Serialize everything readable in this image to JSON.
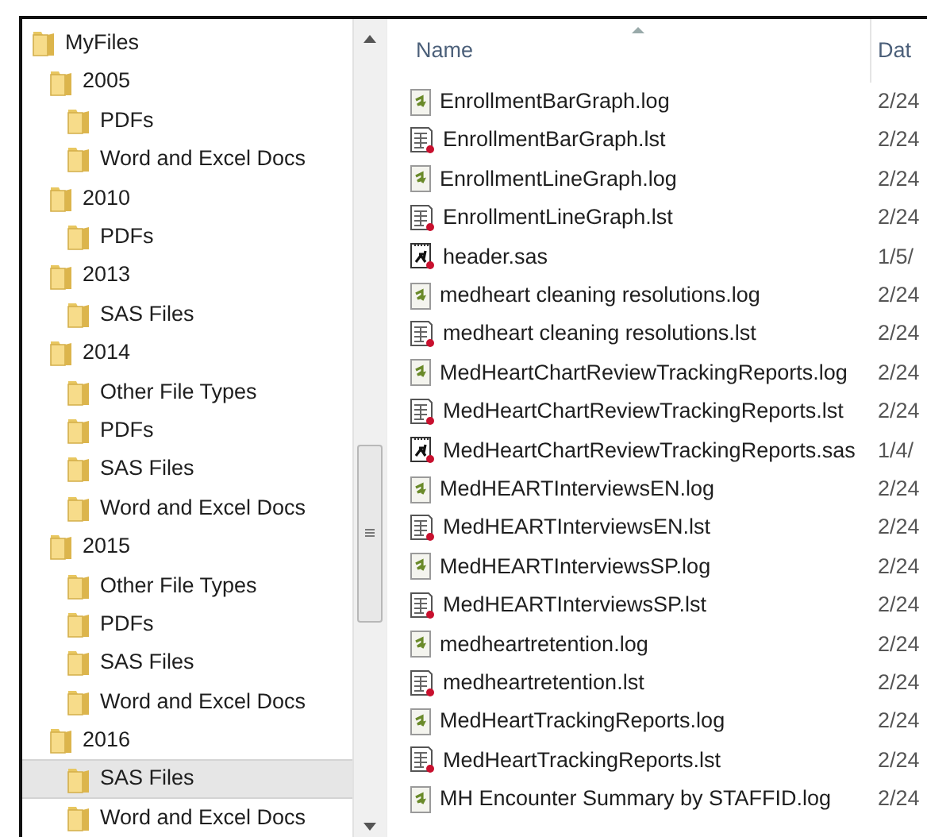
{
  "folder_tree": {
    "label": "MyFiles",
    "selected": false,
    "children": [
      {
        "label": "2005",
        "selected": false,
        "children": [
          {
            "label": "PDFs",
            "selected": false
          },
          {
            "label": "Word and Excel Docs",
            "selected": false
          }
        ]
      },
      {
        "label": "2010",
        "selected": false,
        "children": [
          {
            "label": "PDFs",
            "selected": false
          }
        ]
      },
      {
        "label": "2013",
        "selected": false,
        "children": [
          {
            "label": "SAS Files",
            "selected": false
          }
        ]
      },
      {
        "label": "2014",
        "selected": false,
        "children": [
          {
            "label": "Other File Types",
            "selected": false
          },
          {
            "label": "PDFs",
            "selected": false
          },
          {
            "label": "SAS Files",
            "selected": false
          },
          {
            "label": "Word and Excel Docs",
            "selected": false
          }
        ]
      },
      {
        "label": "2015",
        "selected": false,
        "children": [
          {
            "label": "Other File Types",
            "selected": false
          },
          {
            "label": "PDFs",
            "selected": false
          },
          {
            "label": "SAS Files",
            "selected": false
          },
          {
            "label": "Word and Excel Docs",
            "selected": false
          }
        ]
      },
      {
        "label": "2016",
        "selected": false,
        "children": [
          {
            "label": "SAS Files",
            "selected": true
          },
          {
            "label": "Word and Excel Docs",
            "selected": false
          }
        ]
      }
    ]
  },
  "file_list": {
    "columns": [
      "Name",
      "Dat"
    ],
    "rows": [
      {
        "name": "EnrollmentBarGraph.log",
        "kind": "log",
        "date": "2/24"
      },
      {
        "name": "EnrollmentBarGraph.lst",
        "kind": "lst",
        "date": "2/24"
      },
      {
        "name": "EnrollmentLineGraph.log",
        "kind": "log",
        "date": "2/24"
      },
      {
        "name": "EnrollmentLineGraph.lst",
        "kind": "lst",
        "date": "2/24"
      },
      {
        "name": "header.sas",
        "kind": "sas",
        "date": "1/5/"
      },
      {
        "name": "medheart cleaning resolutions.log",
        "kind": "log",
        "date": "2/24"
      },
      {
        "name": "medheart cleaning resolutions.lst",
        "kind": "lst",
        "date": "2/24"
      },
      {
        "name": "MedHeartChartReviewTrackingReports.log",
        "kind": "log",
        "date": "2/24"
      },
      {
        "name": "MedHeartChartReviewTrackingReports.lst",
        "kind": "lst",
        "date": "2/24"
      },
      {
        "name": "MedHeartChartReviewTrackingReports.sas",
        "kind": "sas",
        "date": "1/4/"
      },
      {
        "name": "MedHEARTInterviewsEN.log",
        "kind": "log",
        "date": "2/24"
      },
      {
        "name": "MedHEARTInterviewsEN.lst",
        "kind": "lst",
        "date": "2/24"
      },
      {
        "name": "MedHEARTInterviewsSP.log",
        "kind": "log",
        "date": "2/24"
      },
      {
        "name": "MedHEARTInterviewsSP.lst",
        "kind": "lst",
        "date": "2/24"
      },
      {
        "name": "medheartretention.log",
        "kind": "log",
        "date": "2/24"
      },
      {
        "name": "medheartretention.lst",
        "kind": "lst",
        "date": "2/24"
      },
      {
        "name": "MedHeartTrackingReports.log",
        "kind": "log",
        "date": "2/24"
      },
      {
        "name": "MedHeartTrackingReports.lst",
        "kind": "lst",
        "date": "2/24"
      },
      {
        "name": "MH Encounter Summary by STAFFID.log",
        "kind": "log",
        "date": "2/24"
      }
    ]
  }
}
